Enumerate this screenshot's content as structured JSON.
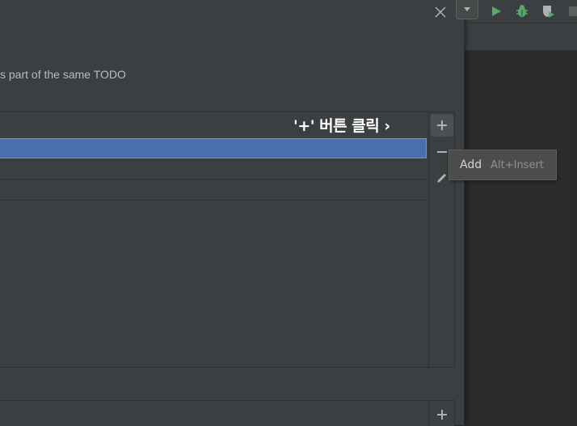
{
  "dialog": {
    "description": "s part of the same TODO"
  },
  "patterns_panel": {
    "rows": [
      {
        "selected": true
      },
      {
        "selected": false
      },
      {
        "selected": false
      }
    ]
  },
  "annotation": {
    "text": "'+' 버튼 클릭 ›"
  },
  "tooltip": {
    "label": "Add",
    "shortcut": "Alt+Insert"
  },
  "toolbar_icons": [
    "run-icon",
    "debug-icon",
    "coverage-icon",
    "stop-icon"
  ],
  "colors": {
    "dialog_bg": "#3c3f41",
    "selection": "#4b6eaf",
    "run_green": "#59a869"
  }
}
